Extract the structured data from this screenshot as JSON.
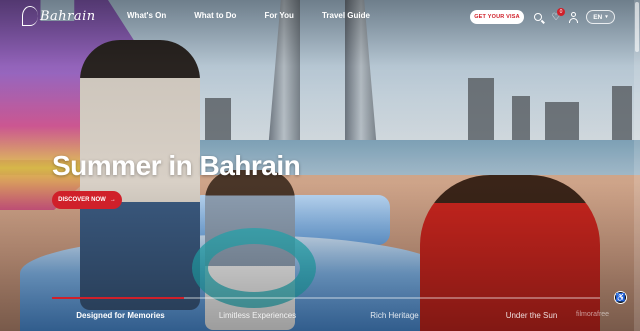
{
  "header": {
    "logo_text": "Bahrain",
    "nav": [
      "What's On",
      "What to Do",
      "For You",
      "Travel Guide"
    ],
    "visa_button": "GET YOUR VISA",
    "wishlist_count": "0",
    "language": "EN"
  },
  "hero": {
    "title": "Summer in Bahrain",
    "cta": "DISCOVER NOW",
    "cta_arrow": "→"
  },
  "tabs": [
    {
      "label": "Designed for Memories",
      "active": true
    },
    {
      "label": "Limitless Experiences",
      "active": false
    },
    {
      "label": "Rich Heritage",
      "active": false
    },
    {
      "label": "Under the Sun",
      "active": false
    }
  ],
  "progress": 0.24,
  "watermark": "filmorafree",
  "colors": {
    "accent": "#d0202a",
    "text": "#ffffff"
  },
  "icons": [
    "search-icon",
    "heart-icon",
    "user-icon",
    "chevron-down-icon",
    "accessibility-icon",
    "arrow-right-icon"
  ]
}
